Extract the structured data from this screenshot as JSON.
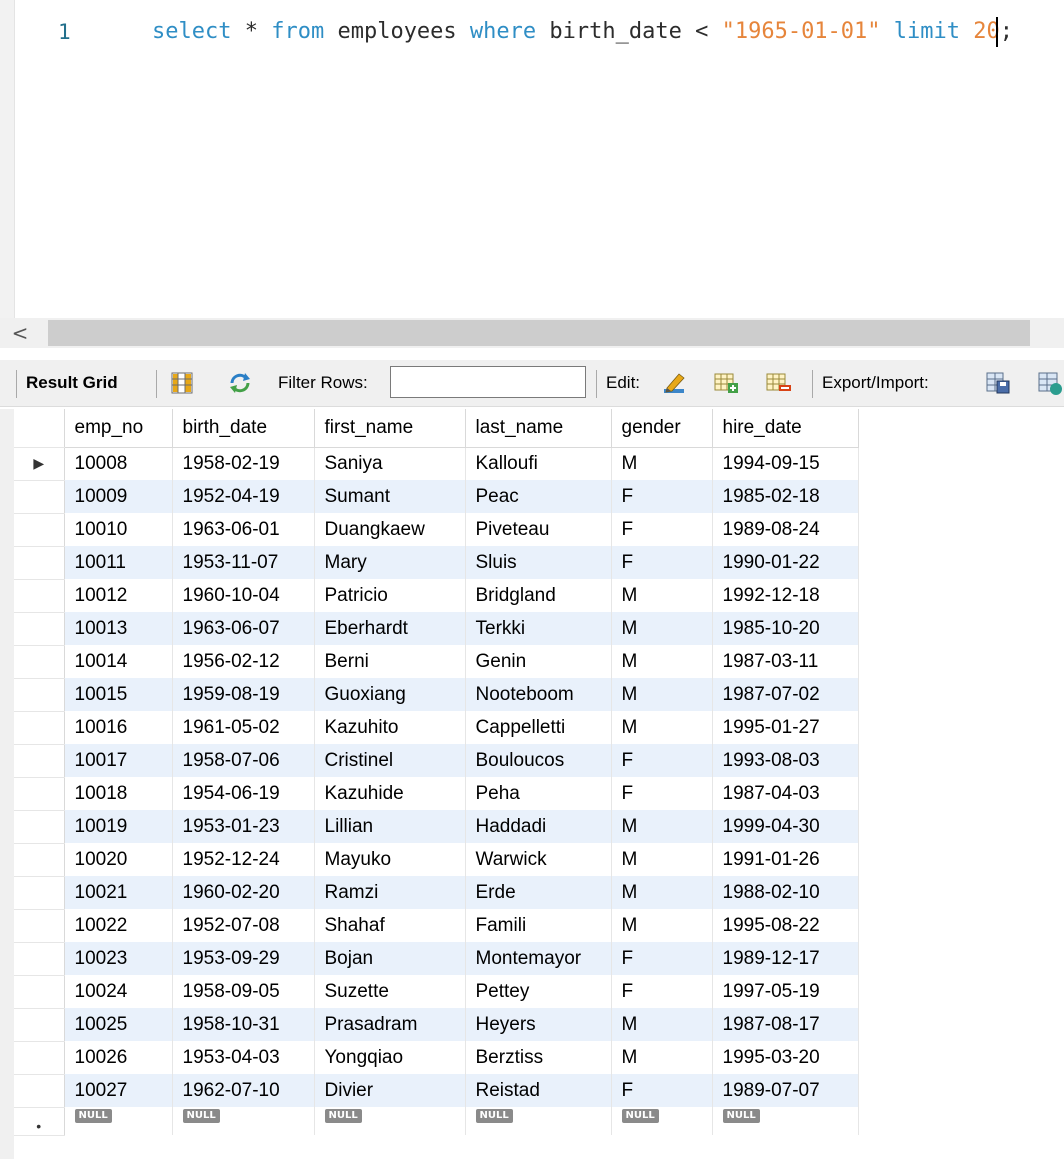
{
  "editor": {
    "line_number": "1",
    "tokens": {
      "select": "select",
      "star": " * ",
      "from": "from",
      "table": " employees ",
      "where": "where",
      "cond": " birth_date < ",
      "date": "\"1965-01-01\"",
      "limit": " limit ",
      "limit_a": "2",
      "limit_b": "0",
      "semicolon": ";"
    }
  },
  "scrollbar": {
    "left_arrow": "<"
  },
  "toolbar": {
    "result_grid": "Result Grid",
    "filter_rows": "Filter Rows:",
    "filter_value": "",
    "edit": "Edit:",
    "export_import": "Export/Import:"
  },
  "grid": {
    "columns": [
      "emp_no",
      "birth_date",
      "first_name",
      "last_name",
      "gender",
      "hire_date"
    ],
    "rows": [
      [
        "10008",
        "1958-02-19",
        "Saniya",
        "Kalloufi",
        "M",
        "1994-09-15"
      ],
      [
        "10009",
        "1952-04-19",
        "Sumant",
        "Peac",
        "F",
        "1985-02-18"
      ],
      [
        "10010",
        "1963-06-01",
        "Duangkaew",
        "Piveteau",
        "F",
        "1989-08-24"
      ],
      [
        "10011",
        "1953-11-07",
        "Mary",
        "Sluis",
        "F",
        "1990-01-22"
      ],
      [
        "10012",
        "1960-10-04",
        "Patricio",
        "Bridgland",
        "M",
        "1992-12-18"
      ],
      [
        "10013",
        "1963-06-07",
        "Eberhardt",
        "Terkki",
        "M",
        "1985-10-20"
      ],
      [
        "10014",
        "1956-02-12",
        "Berni",
        "Genin",
        "M",
        "1987-03-11"
      ],
      [
        "10015",
        "1959-08-19",
        "Guoxiang",
        "Nooteboom",
        "M",
        "1987-07-02"
      ],
      [
        "10016",
        "1961-05-02",
        "Kazuhito",
        "Cappelletti",
        "M",
        "1995-01-27"
      ],
      [
        "10017",
        "1958-07-06",
        "Cristinel",
        "Bouloucos",
        "F",
        "1993-08-03"
      ],
      [
        "10018",
        "1954-06-19",
        "Kazuhide",
        "Peha",
        "F",
        "1987-04-03"
      ],
      [
        "10019",
        "1953-01-23",
        "Lillian",
        "Haddadi",
        "M",
        "1999-04-30"
      ],
      [
        "10020",
        "1952-12-24",
        "Mayuko",
        "Warwick",
        "M",
        "1991-01-26"
      ],
      [
        "10021",
        "1960-02-20",
        "Ramzi",
        "Erde",
        "M",
        "1988-02-10"
      ],
      [
        "10022",
        "1952-07-08",
        "Shahaf",
        "Famili",
        "M",
        "1995-08-22"
      ],
      [
        "10023",
        "1953-09-29",
        "Bojan",
        "Montemayor",
        "F",
        "1989-12-17"
      ],
      [
        "10024",
        "1958-09-05",
        "Suzette",
        "Pettey",
        "F",
        "1997-05-19"
      ],
      [
        "10025",
        "1958-10-31",
        "Prasadram",
        "Heyers",
        "M",
        "1987-08-17"
      ],
      [
        "10026",
        "1953-04-03",
        "Yongqiao",
        "Berztiss",
        "M",
        "1995-03-20"
      ],
      [
        "10027",
        "1962-07-10",
        "Divier",
        "Reistad",
        "F",
        "1989-07-07"
      ]
    ],
    "null_label": "NULL",
    "current_row_marker": "▶",
    "new_row_marker": "•"
  }
}
